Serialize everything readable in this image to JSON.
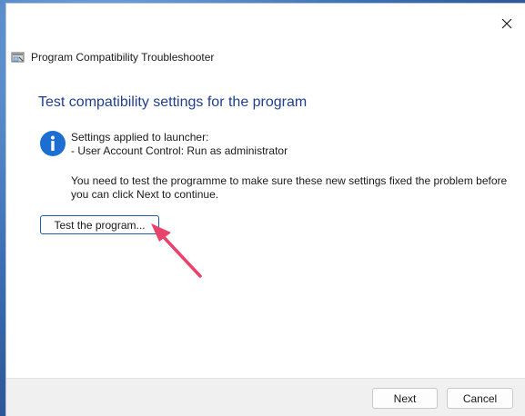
{
  "window": {
    "title": "Program Compatibility Troubleshooter",
    "close_icon": "close-icon",
    "title_icon": "troubleshooter-icon"
  },
  "main": {
    "heading": "Test compatibility settings for the program",
    "info_icon": "info-icon",
    "settings_line1": "Settings applied to launcher:",
    "settings_line2": "- User Account Control:  Run as administrator",
    "instruction": "You need to test the programme to make sure these new settings fixed the problem before you can click Next to continue.",
    "test_button_label": "Test the program..."
  },
  "annotation": {
    "arrow_icon": "pointer-arrow-icon",
    "arrow_color": "#e8436a"
  },
  "footer": {
    "next_label": "Next",
    "cancel_label": "Cancel"
  },
  "colors": {
    "heading": "#1f3f8f",
    "info_icon": "#1c6fd1",
    "button_focus_border": "#1b5faa"
  }
}
